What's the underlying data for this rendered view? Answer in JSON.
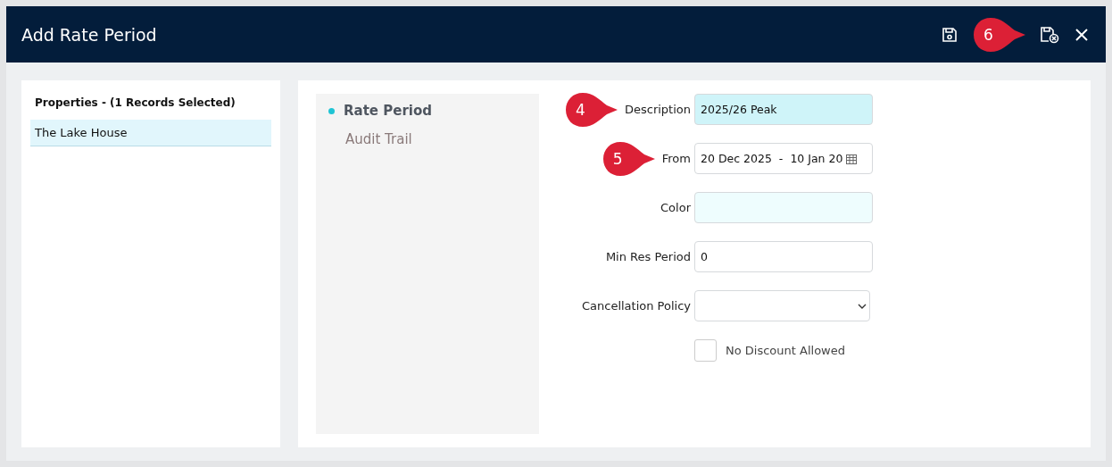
{
  "window": {
    "title": "Add Rate Period"
  },
  "toolbar": [
    {
      "kind": "save"
    },
    {
      "kind": "callout",
      "text": "6"
    },
    {
      "kind": "save_close"
    },
    {
      "kind": "close"
    }
  ],
  "properties": {
    "heading": "Properties - (1 Records Selected)",
    "items": [
      {
        "label": "The Lake House",
        "selected": true
      }
    ]
  },
  "nav": [
    {
      "label": "Rate Period",
      "selected": true
    },
    {
      "label": "Audit Trail",
      "selected": false
    }
  ],
  "form": [
    {
      "kind": "text",
      "label": "Description",
      "value": "2025/26 Peak",
      "callout": "4",
      "highlighted": true
    },
    {
      "kind": "daterange",
      "label": "From",
      "start": "20 Dec 2025",
      "separator": "-",
      "end": "10 Jan 20",
      "callout": "5"
    },
    {
      "kind": "color",
      "label": "Color"
    },
    {
      "kind": "text",
      "label": "Min Res Period",
      "value": "0",
      "highlighted": false
    },
    {
      "kind": "select",
      "label": "Cancellation Policy"
    },
    {
      "kind": "checkbox",
      "label": "No Discount Allowed",
      "checked": false
    }
  ]
}
